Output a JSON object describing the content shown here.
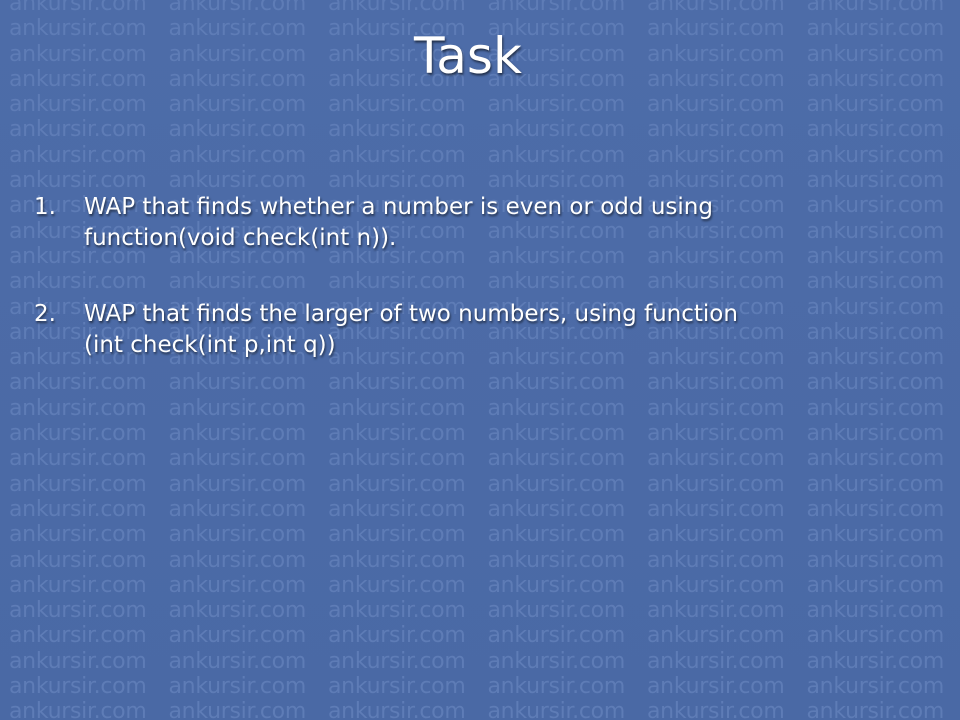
{
  "slide": {
    "title": "Task",
    "watermark": "ankursir.com",
    "tasks": [
      {
        "number": "1.",
        "text": "WAP that finds whether a number is even or odd using function(void check(int n))."
      },
      {
        "number": "2.",
        "text": "WAP that finds the larger of two numbers, using function (int check(int p,int q))"
      }
    ]
  },
  "colors": {
    "background": "#4b6aa6",
    "watermark": "#5e7cb6",
    "text": "#ffffff"
  }
}
